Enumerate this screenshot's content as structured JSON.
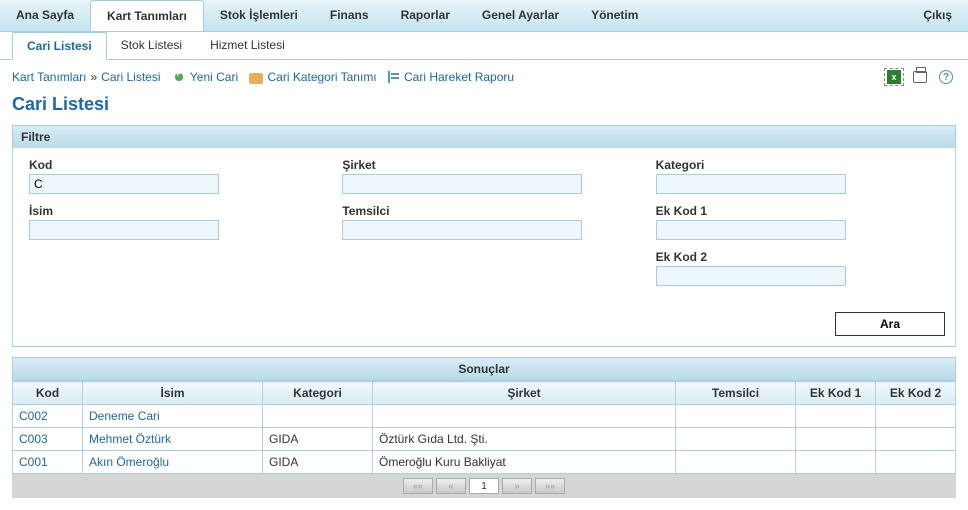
{
  "topnav": {
    "items": [
      "Ana Sayfa",
      "Kart Tanımları",
      "Stok İşlemleri",
      "Finans",
      "Raporlar",
      "Genel Ayarlar",
      "Yönetim"
    ],
    "exit": "Çıkış"
  },
  "subnav": {
    "items": [
      "Cari Listesi",
      "Stok Listesi",
      "Hizmet Listesi"
    ]
  },
  "breadcrumb": {
    "part1": "Kart Tanımları",
    "sep": " » ",
    "part2": "Cari Listesi",
    "action_new": "Yeni Cari",
    "action_cat": "Cari Kategori Tanımı",
    "action_report": "Cari Hareket Raporu"
  },
  "page_title": "Cari Listesi",
  "filter": {
    "header": "Filtre",
    "kod_label": "Kod",
    "kod_value": "C",
    "isim_label": "İsim",
    "isim_value": "",
    "sirket_label": "Şirket",
    "sirket_value": "",
    "temsilci_label": "Temsilci",
    "temsilci_value": "",
    "kategori_label": "Kategori",
    "kategori_value": "",
    "ek1_label": "Ek Kod 1",
    "ek1_value": "",
    "ek2_label": "Ek Kod 2",
    "ek2_value": "",
    "search_btn": "Ara"
  },
  "results": {
    "title": "Sonuçlar",
    "headers": {
      "kod": "Kod",
      "isim": "İsim",
      "kategori": "Kategori",
      "sirket": "Şirket",
      "temsilci": "Temsilci",
      "ek1": "Ek Kod 1",
      "ek2": "Ek Kod 2"
    },
    "rows": [
      {
        "kod": "C002",
        "isim": "Deneme Cari",
        "kategori": "",
        "sirket": "",
        "temsilci": "",
        "ek1": "",
        "ek2": ""
      },
      {
        "kod": "C003",
        "isim": "Mehmet Öztürk",
        "kategori": "GIDA",
        "sirket": "Öztürk Gıda Ltd. Şti.",
        "temsilci": "",
        "ek1": "",
        "ek2": ""
      },
      {
        "kod": "C001",
        "isim": "Akın Ömeroğlu",
        "kategori": "GIDA",
        "sirket": "Ömeroğlu Kuru Bakliyat",
        "temsilci": "",
        "ek1": "",
        "ek2": ""
      }
    ]
  },
  "paginator": {
    "first": "««",
    "prev": "«",
    "page": "1",
    "next": "»",
    "last": "»»"
  }
}
